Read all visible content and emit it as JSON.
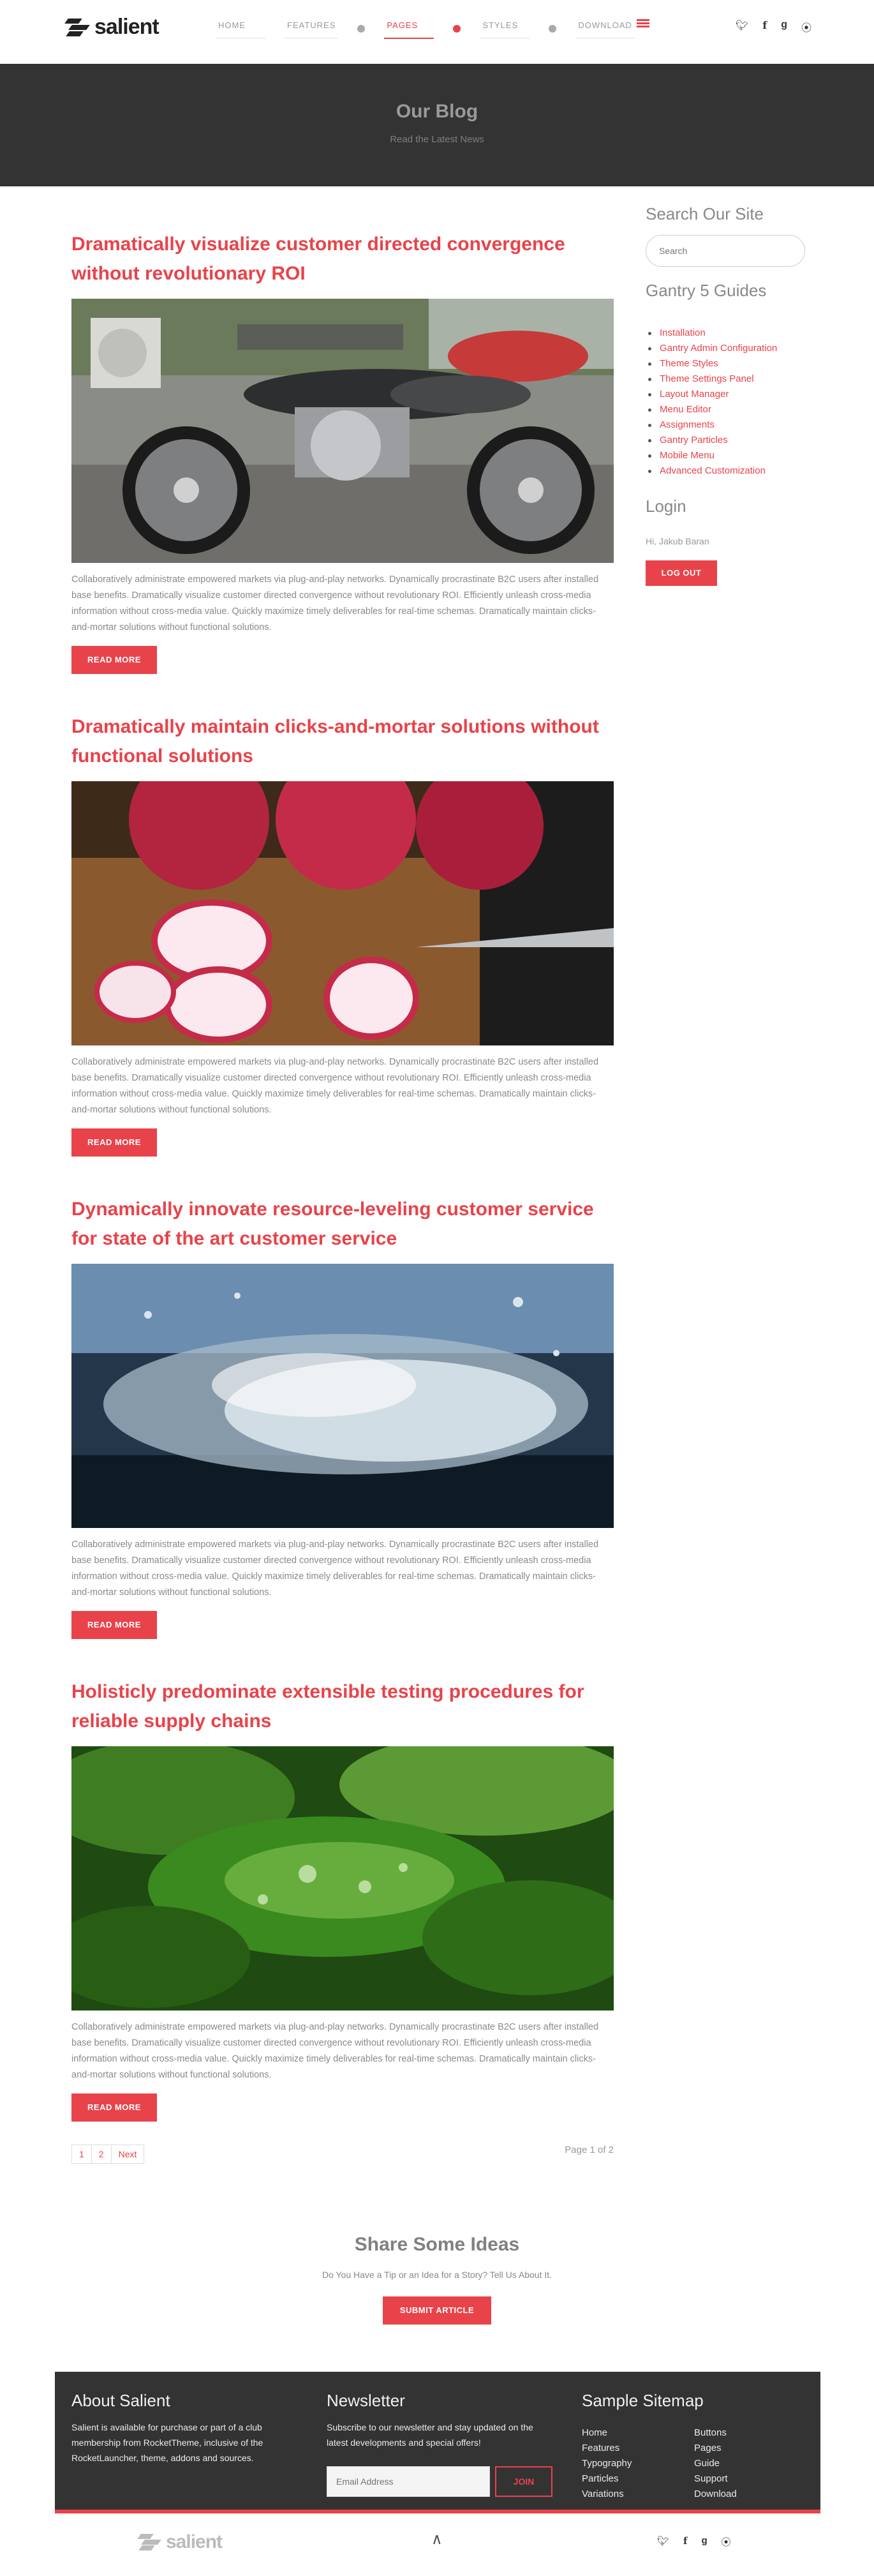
{
  "brand": {
    "name": "salient"
  },
  "nav": {
    "items": [
      {
        "label": "HOME"
      },
      {
        "label": "FEATURES"
      },
      {
        "label": "PAGES"
      },
      {
        "label": "STYLES"
      },
      {
        "label": "DOWNLOAD"
      }
    ],
    "active": "PAGES"
  },
  "social": [
    "twitter-icon",
    "facebook-icon",
    "google-plus-icon",
    "rss-icon"
  ],
  "hero": {
    "title": "Our Blog",
    "subtitle": "Read the Latest News"
  },
  "posts": [
    {
      "title": "Dramatically visualize customer directed convergence without revolutionary ROI",
      "image": "motorcycle",
      "text": "Collaboratively administrate empowered markets via plug-and-play networks. Dynamically procrastinate B2C users after installed base benefits. Dramatically visualize customer directed convergence without revolutionary ROI. Efficiently unleash cross-media information without cross-media value. Quickly maximize timely deliverables for real-time schemas. Dramatically maintain clicks-and-mortar solutions without functional solutions.",
      "button": "READ MORE"
    },
    {
      "title": "Dramatically maintain clicks-and-mortar solutions without functional solutions",
      "image": "radishes",
      "text": "Collaboratively administrate empowered markets via plug-and-play networks. Dynamically procrastinate B2C users after installed base benefits. Dramatically visualize customer directed convergence without revolutionary ROI. Efficiently unleash cross-media information without cross-media value. Quickly maximize timely deliverables for real-time schemas. Dramatically maintain clicks-and-mortar solutions without functional solutions.",
      "button": "READ MORE"
    },
    {
      "title": "Dynamically innovate resource-leveling customer service for state of the art customer service",
      "image": "water-splash",
      "text": "Collaboratively administrate empowered markets via plug-and-play networks. Dynamically procrastinate B2C users after installed base benefits. Dramatically visualize customer directed convergence without revolutionary ROI. Efficiently unleash cross-media information without cross-media value. Quickly maximize timely deliverables for real-time schemas. Dramatically maintain clicks-and-mortar solutions without functional solutions.",
      "button": "READ MORE"
    },
    {
      "title": "Holisticly predominate extensible testing procedures for reliable supply chains",
      "image": "green-leaves",
      "text": "Collaboratively administrate empowered markets via plug-and-play networks. Dynamically procrastinate B2C users after installed base benefits. Dramatically visualize customer directed convergence without revolutionary ROI. Efficiently unleash cross-media information without cross-media value. Quickly maximize timely deliverables for real-time schemas. Dramatically maintain clicks-and-mortar solutions without functional solutions.",
      "button": "READ MORE"
    }
  ],
  "pagination": {
    "pages": [
      "1",
      "2"
    ],
    "next": "Next",
    "status": "Page 1 of 2"
  },
  "sidebar": {
    "search_heading": "Search Our Site",
    "search_placeholder": "Search",
    "guides_heading": "Gantry 5 Guides",
    "guides": [
      "Installation",
      "Gantry Admin Configuration",
      "Theme Styles",
      "Theme Settings Panel",
      "Layout Manager",
      "Menu Editor",
      "Assignments",
      "Gantry Particles",
      "Mobile Menu",
      "Advanced Customization"
    ],
    "login_heading": "Login",
    "greeting": "Hi, Jakub Baran",
    "logout": "LOG OUT"
  },
  "share": {
    "title": "Share Some Ideas",
    "subtitle": "Do You Have a Tip or an Idea for a Story? Tell Us About It.",
    "button": "SUBMIT ARTICLE"
  },
  "footer": {
    "about_heading": "About Salient",
    "about_text": "Salient is available for purchase or part of a club membership from RocketTheme, inclusive of the RocketLauncher, theme, addons and sources.",
    "newsletter_heading": "Newsletter",
    "newsletter_text": "Subscribe to our newsletter and stay updated on the latest developments and special offers!",
    "email_placeholder": "Email Address",
    "join": "JOIN",
    "sitemap_heading": "Sample Sitemap",
    "sitemap": [
      "Home",
      "Buttons",
      "Features",
      "Pages",
      "Typography",
      "Guide",
      "Particles",
      "Support",
      "Variations",
      "Download"
    ]
  },
  "colors": {
    "accent": "#e8434a",
    "hero_bg": "#333333",
    "footer_bg": "#333333"
  }
}
